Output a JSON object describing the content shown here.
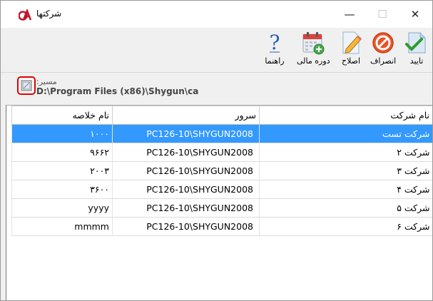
{
  "window": {
    "title": "شرکتها",
    "controls": {
      "minimize": "—",
      "maximize": "☐",
      "close": "✕"
    }
  },
  "toolbar": {
    "buttons": [
      {
        "id": "approve",
        "label": "تایید",
        "icon": "checkmark-document-icon"
      },
      {
        "id": "cancel",
        "label": "انصراف",
        "icon": "no-entry-icon"
      },
      {
        "id": "edit",
        "label": "اصلاح",
        "icon": "pencil-edit-icon"
      },
      {
        "id": "fiscal",
        "label": "دوره مالی",
        "icon": "calendar-icon"
      },
      {
        "id": "help",
        "label": "راهنما",
        "icon": "question-icon"
      }
    ]
  },
  "path": {
    "label": "مسیر:",
    "value": "D:\\Program Files (x86)\\Shygun\\ca"
  },
  "table": {
    "columns": {
      "name": "نام شرکت",
      "server": "سرور",
      "abbr": "نام خلاصه"
    },
    "rows": [
      {
        "name": "شرکت تست",
        "server": "PC126-10\\SHYGUN2008",
        "abbr": "۱۰۰۰",
        "selected": true
      },
      {
        "name": "شرکت ۲",
        "server": "PC126-10\\SHYGUN2008",
        "abbr": "۹۶۶۲",
        "selected": false
      },
      {
        "name": "شرکت ۳",
        "server": "PC126-10\\SHYGUN2008",
        "abbr": "۲۰۰۳",
        "selected": false
      },
      {
        "name": "شرکت ۴",
        "server": "PC126-10\\SHYGUN2008",
        "abbr": "۳۶۰۰",
        "selected": false
      },
      {
        "name": "شرکت ۵",
        "server": "PC126-10\\SHYGUN2008",
        "abbr": "yyyy",
        "selected": false
      },
      {
        "name": "شرکت ۶",
        "server": "PC126-10\\SHYGUN2008",
        "abbr": "mmmm",
        "selected": false
      }
    ]
  },
  "colors": {
    "selection": "#3399ff",
    "highlight_border": "#e00000"
  }
}
